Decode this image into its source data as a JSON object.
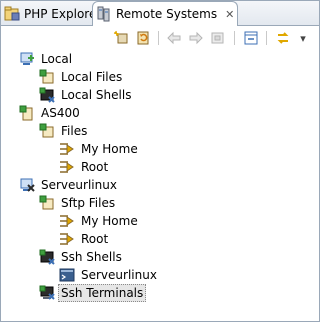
{
  "tabs": [
    {
      "label": "PHP Explorer",
      "icon": "php-explorer-icon",
      "active": false
    },
    {
      "label": "Remote Systems",
      "icon": "remote-systems-icon",
      "active": true,
      "close": "✕"
    }
  ],
  "toolbar": {
    "buttons": [
      {
        "name": "new-connection-icon",
        "enabled": true
      },
      {
        "name": "refresh-icon",
        "enabled": true
      },
      {
        "name": "back-arrow-icon",
        "enabled": false
      },
      {
        "name": "forward-arrow-icon",
        "enabled": false
      },
      {
        "name": "home-icon",
        "enabled": false
      },
      {
        "name": "collapse-all-icon",
        "enabled": true
      },
      {
        "name": "link-with-editor-icon",
        "enabled": true
      }
    ],
    "menu_glyph": "▾"
  },
  "tree": [
    {
      "label": "Local",
      "icon": "local-host-icon",
      "depth": 0
    },
    {
      "label": "Local Files",
      "icon": "files-subsystem-icon",
      "depth": 1
    },
    {
      "label": "Local Shells",
      "icon": "shells-subsystem-icon",
      "depth": 1
    },
    {
      "label": "AS400",
      "icon": "connection-icon",
      "depth": 0
    },
    {
      "label": "Files",
      "icon": "files-subsystem-icon",
      "depth": 1
    },
    {
      "label": "My Home",
      "icon": "filter-icon",
      "depth": 2
    },
    {
      "label": "Root",
      "icon": "filter-icon",
      "depth": 2
    },
    {
      "label": "Serveurlinux",
      "icon": "linux-host-icon",
      "depth": 0
    },
    {
      "label": "Sftp Files",
      "icon": "files-subsystem-icon",
      "depth": 1
    },
    {
      "label": "My Home",
      "icon": "filter-icon",
      "depth": 2
    },
    {
      "label": "Root",
      "icon": "filter-icon",
      "depth": 2
    },
    {
      "label": "Ssh Shells",
      "icon": "shells-subsystem-icon",
      "depth": 1
    },
    {
      "label": "Serveurlinux",
      "icon": "shell-instance-icon",
      "depth": 2
    },
    {
      "label": "Ssh Terminals",
      "icon": "terminals-subsystem-icon",
      "depth": 1,
      "selected": true
    }
  ],
  "colors": {
    "border": "#9aa8b8",
    "selection": "#e6e6e6",
    "icon_green": "#3f9f3f",
    "icon_blue": "#3c6fb4",
    "icon_brown": "#8a6a2a"
  }
}
